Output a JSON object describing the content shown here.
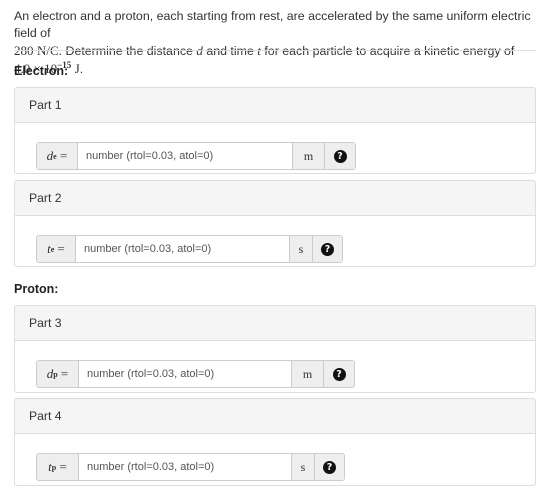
{
  "question": {
    "text_a": "An electron and a proton, each starting from rest, are accelerated by the same uniform electric field of",
    "field_value": "280",
    "field_unit": "N/C",
    "text_b": ". Determine the distance ",
    "var_d": "d",
    "text_c": " and time ",
    "var_t": "t",
    "text_d": " for each particle to acquire a kinetic energy of ",
    "energy_mantissa": "4.0 × 10",
    "energy_exponent": "−15",
    "energy_unit": "J",
    "text_end": "."
  },
  "sections": {
    "electron": "Electron:",
    "proton": "Proton:"
  },
  "parts": [
    {
      "title": "Part 1",
      "var": "d",
      "sub": "e",
      "eq": "=",
      "placeholder": "number (rtol=0.03, atol=0)",
      "unit": "m",
      "help": "?"
    },
    {
      "title": "Part 2",
      "var": "t",
      "sub": "e",
      "eq": "=",
      "placeholder": "number (rtol=0.03, atol=0)",
      "unit": "s",
      "help": "?"
    },
    {
      "title": "Part 3",
      "var": "d",
      "sub": "p",
      "eq": "=",
      "placeholder": "number (rtol=0.03, atol=0)",
      "unit": "m",
      "help": "?"
    },
    {
      "title": "Part 4",
      "var": "t",
      "sub": "p",
      "eq": "=",
      "placeholder": "number (rtol=0.03, atol=0)",
      "unit": "s",
      "help": "?"
    }
  ]
}
